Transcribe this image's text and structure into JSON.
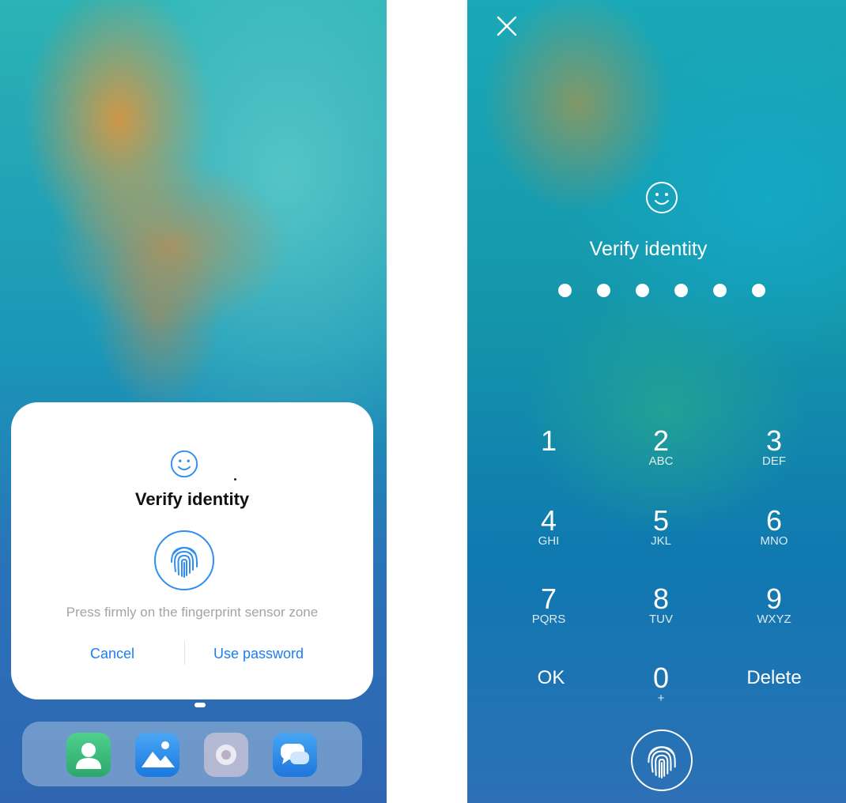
{
  "left_screen": {
    "dialog": {
      "title": "Verify identity",
      "hint": "Press firmly on the fingerprint sensor zone",
      "cancel_label": "Cancel",
      "use_password_label": "Use password",
      "icons": [
        "face-icon",
        "fingerprint-icon"
      ]
    },
    "dock": {
      "apps": [
        "contacts-icon",
        "gallery-icon",
        "camera-icon",
        "messages-icon"
      ]
    }
  },
  "right_screen": {
    "title": "Verify identity",
    "pin_length": 6,
    "keys": [
      {
        "num": "1",
        "sub": ""
      },
      {
        "num": "2",
        "sub": "ABC"
      },
      {
        "num": "3",
        "sub": "DEF"
      },
      {
        "num": "4",
        "sub": "GHI"
      },
      {
        "num": "5",
        "sub": "JKL"
      },
      {
        "num": "6",
        "sub": "MNO"
      },
      {
        "num": "7",
        "sub": "PQRS"
      },
      {
        "num": "8",
        "sub": "TUV"
      },
      {
        "num": "9",
        "sub": "WXYZ"
      },
      {
        "num": "0",
        "sub": "+"
      }
    ],
    "ok_label": "OK",
    "delete_label": "Delete",
    "icons": [
      "close-icon",
      "face-icon",
      "fingerprint-icon"
    ]
  },
  "colors": {
    "accent": "#1a7ef0",
    "hint_gray": "#a4a4a4"
  }
}
